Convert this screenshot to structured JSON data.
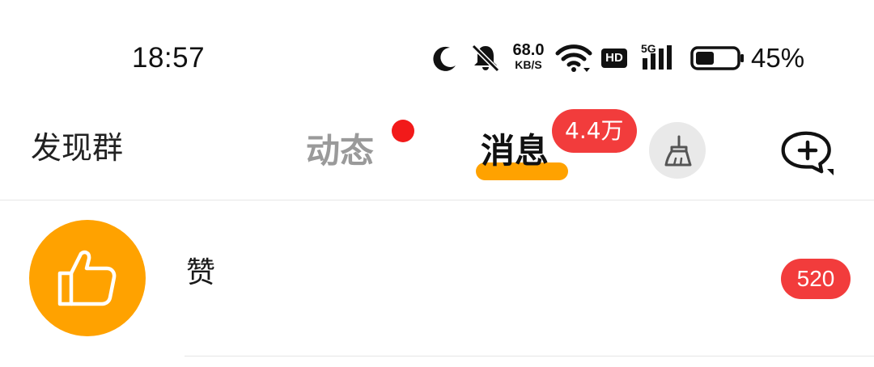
{
  "status_bar": {
    "time": "18:57",
    "network_speed_value": "68.0",
    "network_speed_unit": "KB/S",
    "hd_label": "HD",
    "network_type": "5G",
    "battery_percent": "45%",
    "battery_level": 0.45,
    "icons": [
      "moon-icon",
      "bell-muted-icon",
      "wifi-icon",
      "hd-icon",
      "signal-icon",
      "battery-icon"
    ]
  },
  "header": {
    "discover_label": "发现群",
    "tabs": [
      {
        "label": "动态",
        "active": false,
        "has_dot": true
      },
      {
        "label": "消息",
        "active": true,
        "badge": "4.4万"
      }
    ],
    "clean_icon": "broom-icon",
    "add_chat_icon": "chat-plus-icon"
  },
  "list": [
    {
      "title": "赞",
      "icon": "thumbs-up-icon",
      "badge": "520"
    }
  ],
  "colors": {
    "accent": "#ffa200",
    "badge": "#f23c3c",
    "dot": "#f21a1a",
    "inactive_tab": "#9a9a9a"
  }
}
